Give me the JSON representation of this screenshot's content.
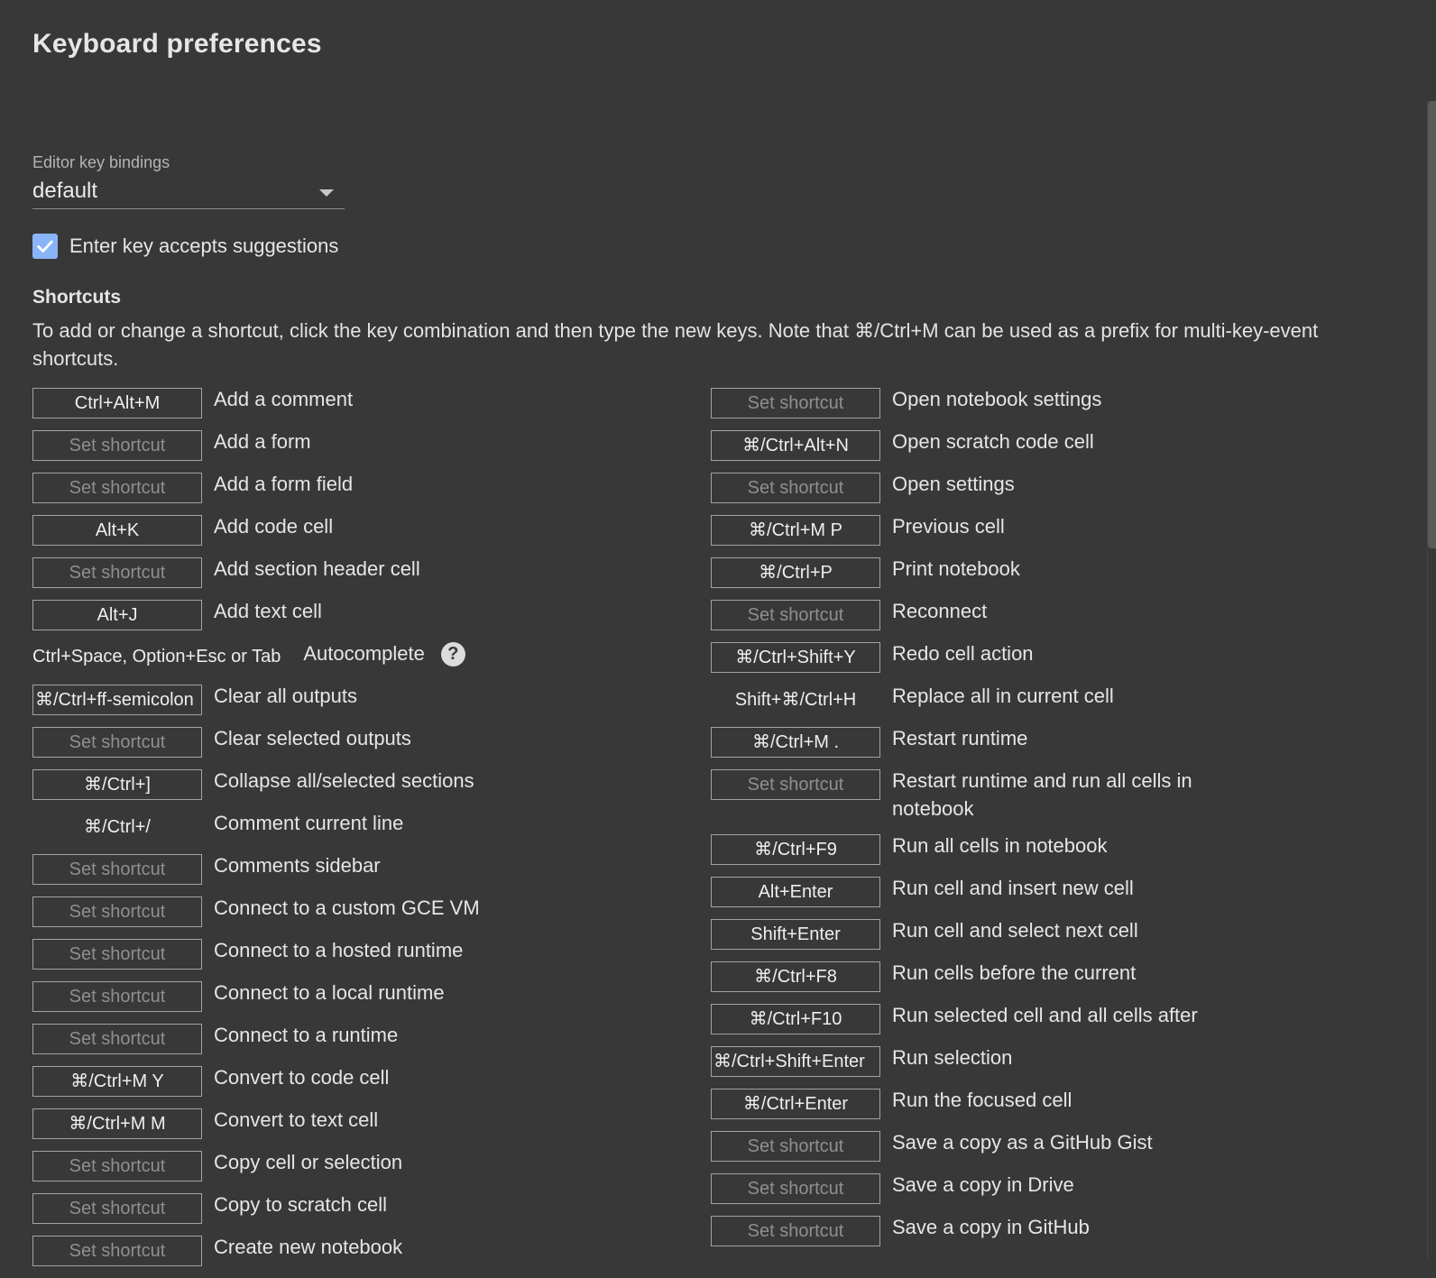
{
  "page": {
    "title": "Keyboard preferences"
  },
  "editor_bindings": {
    "label": "Editor key bindings",
    "value": "default"
  },
  "enter_key": {
    "label": "Enter key accepts suggestions",
    "checked": true
  },
  "shortcuts": {
    "title": "Shortcuts",
    "description": "To add or change a shortcut, click the key combination and then type the new keys. Note that ⌘/Ctrl+M can be used as a prefix for multi-key-event shortcuts.",
    "left": [
      {
        "key": "Ctrl+Alt+M",
        "action": "Add a comment"
      },
      {
        "key": "Set shortcut",
        "action": "Add a form"
      },
      {
        "key": "Set shortcut",
        "action": "Add a form field"
      },
      {
        "key": "Alt+K",
        "action": "Add code cell"
      },
      {
        "key": "Set shortcut",
        "action": "Add section header cell"
      },
      {
        "key": "Alt+J",
        "action": "Add text cell"
      },
      {
        "key": "Ctrl+Space, Option+Esc or Tab",
        "action": "Autocomplete"
      },
      {
        "key": "⌘/Ctrl+ff-semicolon",
        "action": "Clear all outputs"
      },
      {
        "key": "Set shortcut",
        "action": "Clear selected outputs"
      },
      {
        "key": "⌘/Ctrl+]",
        "action": "Collapse all/selected sections"
      },
      {
        "key": "⌘/Ctrl+/",
        "action": "Comment current line"
      },
      {
        "key": "Set shortcut",
        "action": "Comments sidebar"
      },
      {
        "key": "Set shortcut",
        "action": "Connect to a custom GCE VM"
      },
      {
        "key": "Set shortcut",
        "action": "Connect to a hosted runtime"
      },
      {
        "key": "Set shortcut",
        "action": "Connect to a local runtime"
      },
      {
        "key": "Set shortcut",
        "action": "Connect to a runtime"
      },
      {
        "key": "⌘/Ctrl+M Y",
        "action": "Convert to code cell"
      },
      {
        "key": "⌘/Ctrl+M M",
        "action": "Convert to text cell"
      },
      {
        "key": "Set shortcut",
        "action": "Copy cell or selection"
      },
      {
        "key": "Set shortcut",
        "action": "Copy to scratch cell"
      },
      {
        "key": "Set shortcut",
        "action": "Create new notebook"
      }
    ],
    "right": [
      {
        "key": "Set shortcut",
        "action": "Open notebook settings"
      },
      {
        "key": "⌘/Ctrl+Alt+N",
        "action": "Open scratch code cell"
      },
      {
        "key": "Set shortcut",
        "action": "Open settings"
      },
      {
        "key": "⌘/Ctrl+M P",
        "action": "Previous cell"
      },
      {
        "key": "⌘/Ctrl+P",
        "action": "Print notebook"
      },
      {
        "key": "Set shortcut",
        "action": "Reconnect"
      },
      {
        "key": "⌘/Ctrl+Shift+Y",
        "action": "Redo cell action"
      },
      {
        "key": "Shift+⌘/Ctrl+H",
        "action": "Replace all in current cell"
      },
      {
        "key": "⌘/Ctrl+M .",
        "action": "Restart runtime"
      },
      {
        "key": "Set shortcut",
        "action": "Restart runtime and run all cells in notebook"
      },
      {
        "key": "⌘/Ctrl+F9",
        "action": "Run all cells in notebook"
      },
      {
        "key": "Alt+Enter",
        "action": "Run cell and insert new cell"
      },
      {
        "key": "Shift+Enter",
        "action": "Run cell and select next cell"
      },
      {
        "key": "⌘/Ctrl+F8",
        "action": "Run cells before the current"
      },
      {
        "key": "⌘/Ctrl+F10",
        "action": "Run selected cell and all cells after"
      },
      {
        "key": "⌘/Ctrl+Shift+Enter",
        "action": "Run selection"
      },
      {
        "key": "⌘/Ctrl+Enter",
        "action": "Run the focused cell"
      },
      {
        "key": "Set shortcut",
        "action": "Save a copy as a GitHub Gist"
      },
      {
        "key": "Set shortcut",
        "action": "Save a copy in Drive"
      },
      {
        "key": "Set shortcut",
        "action": "Save a copy in GitHub"
      }
    ]
  },
  "icons": {
    "checkbox": "checkmark-icon",
    "help": "help-icon",
    "dropdown": "chevron-down-icon"
  },
  "colors": {
    "background": "#383838",
    "accent": "#8ab4f8"
  }
}
